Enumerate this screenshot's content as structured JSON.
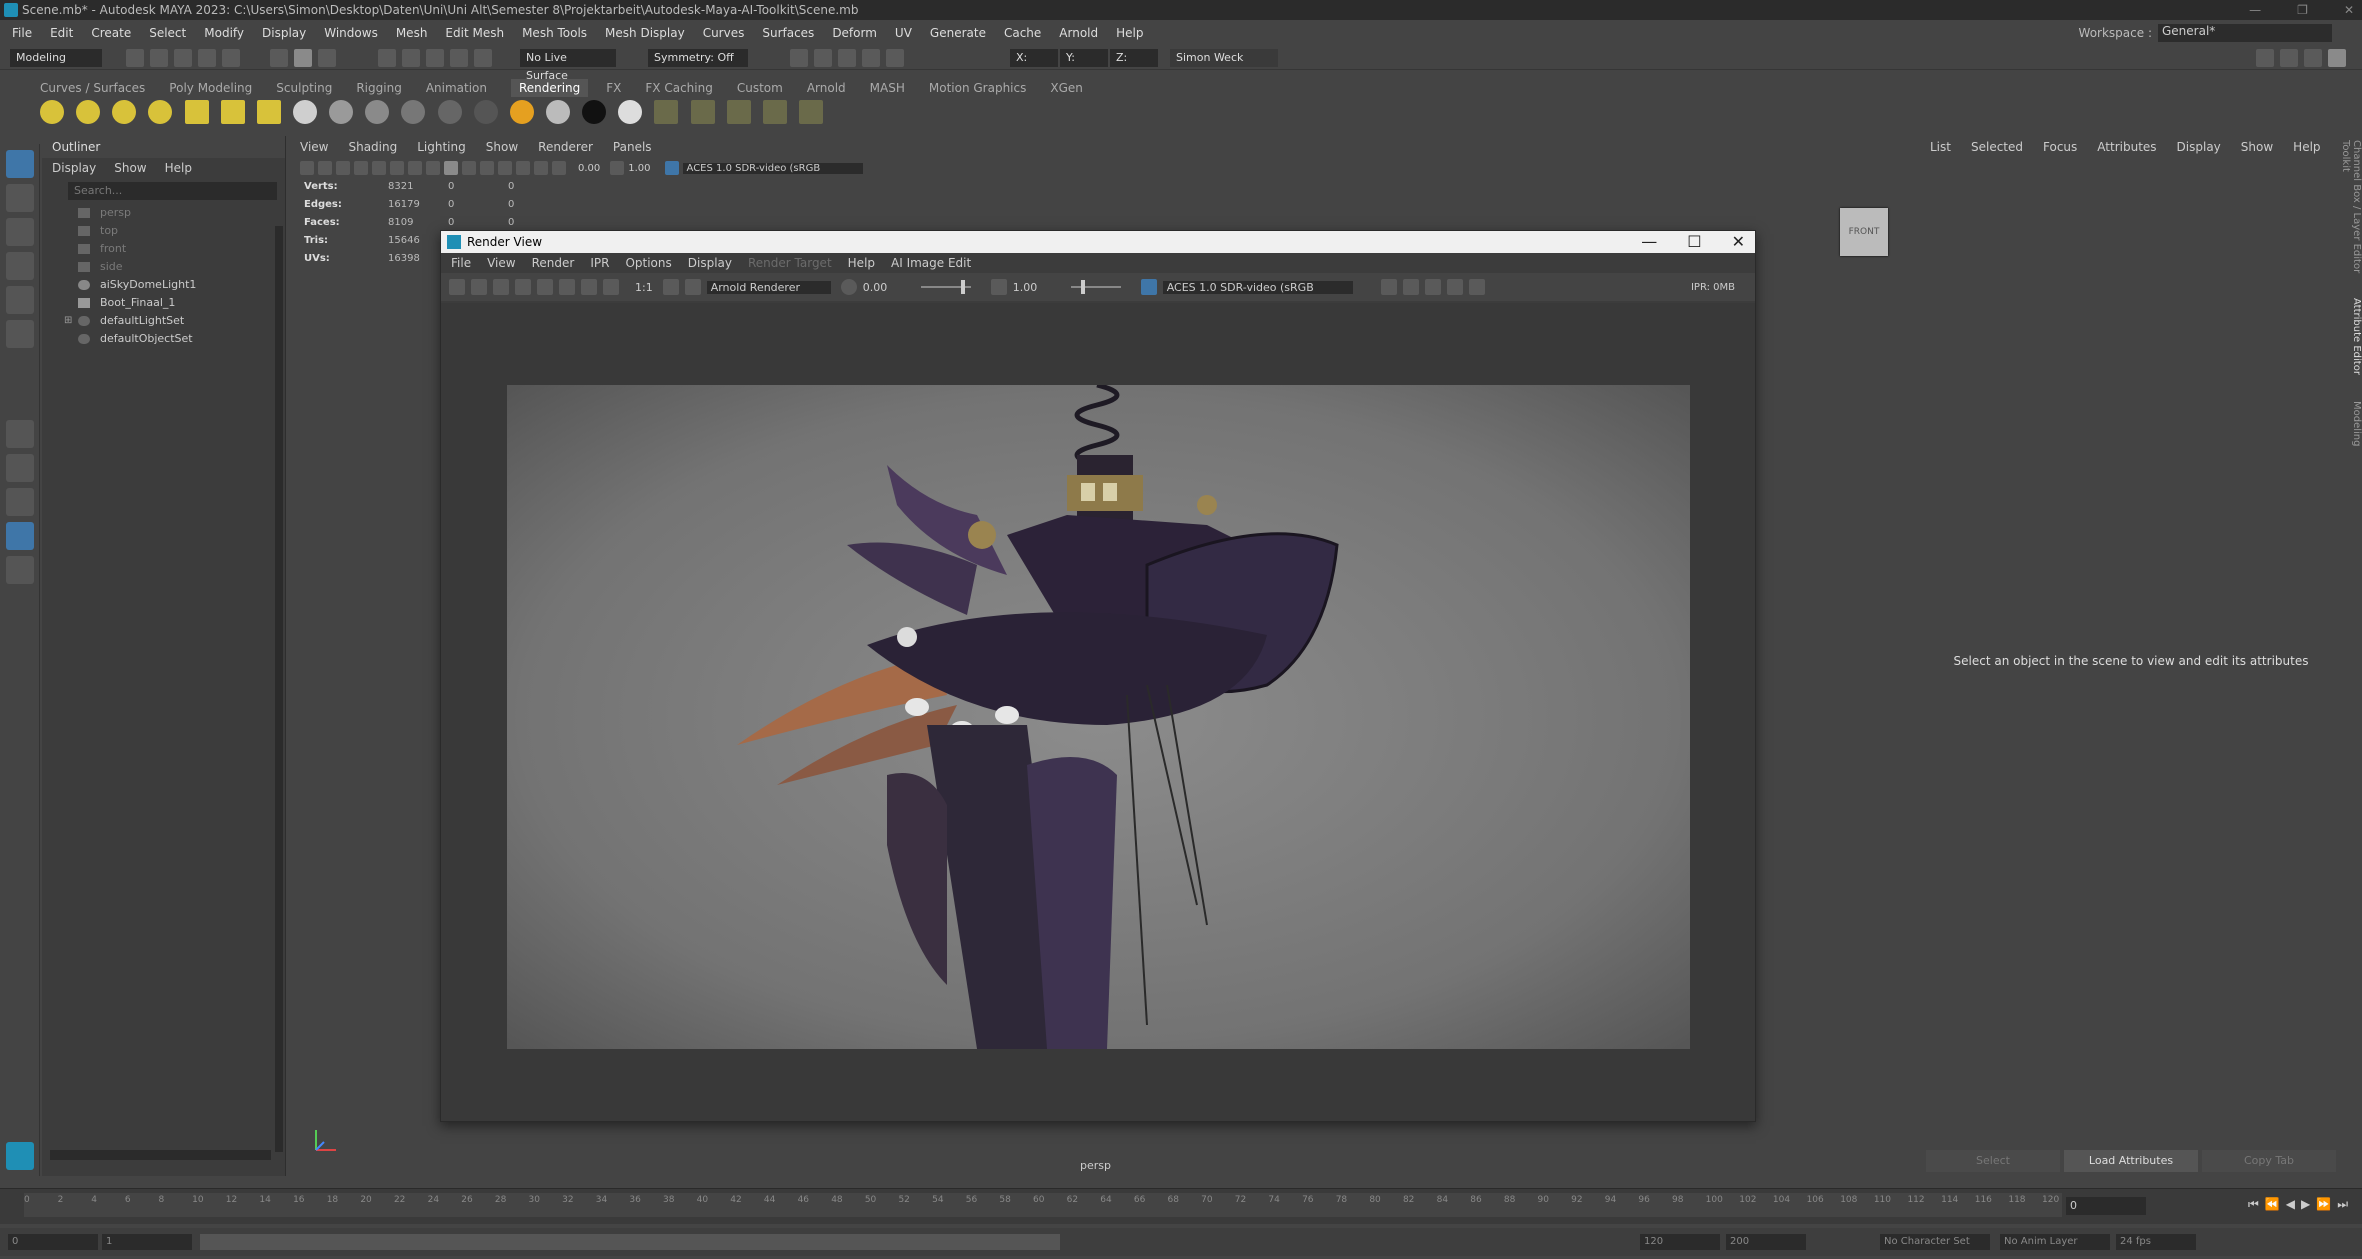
{
  "window": {
    "title": "Scene.mb* - Autodesk MAYA 2023: C:\\Users\\Simon\\Desktop\\Daten\\Uni\\Uni Alt\\Semester 8\\Projektarbeit\\Autodesk-Maya-AI-Toolkit\\Scene.mb"
  },
  "menubar": [
    "File",
    "Edit",
    "Create",
    "Select",
    "Modify",
    "Display",
    "Windows",
    "Mesh",
    "Edit Mesh",
    "Mesh Tools",
    "Mesh Display",
    "Curves",
    "Surfaces",
    "Deform",
    "UV",
    "Generate",
    "Cache",
    "Arnold",
    "Help"
  ],
  "workspace": {
    "label": "Workspace :",
    "value": "General*"
  },
  "statusline": {
    "mode": "Modeling",
    "live_surface": "No Live Surface",
    "symmetry": "Symmetry: Off",
    "x": "X:",
    "y": "Y:",
    "z": "Z:",
    "user": "Simon Weck"
  },
  "shelf_tabs": [
    "Curves / Surfaces",
    "Poly Modeling",
    "Sculpting",
    "Rigging",
    "Animation",
    "Rendering",
    "FX",
    "FX Caching",
    "Custom",
    "Arnold",
    "MASH",
    "Motion Graphics",
    "XGen"
  ],
  "shelf_active": "Rendering",
  "outliner": {
    "title": "Outliner",
    "menu": [
      "Display",
      "Show",
      "Help"
    ],
    "search_placeholder": "Search...",
    "items": [
      {
        "label": "persp",
        "dim": true
      },
      {
        "label": "top",
        "dim": true
      },
      {
        "label": "front",
        "dim": true
      },
      {
        "label": "side",
        "dim": true
      },
      {
        "label": "aiSkyDomeLight1",
        "dim": false
      },
      {
        "label": "Boot_Finaal_1",
        "dim": false
      },
      {
        "label": "defaultLightSet",
        "dim": false
      },
      {
        "label": "defaultObjectSet",
        "dim": false
      }
    ]
  },
  "viewport": {
    "menu": [
      "View",
      "Shading",
      "Lighting",
      "Show",
      "Renderer",
      "Panels"
    ],
    "exposure": "0.00",
    "gamma": "1.00",
    "color_space": "ACES 1.0 SDR-video (sRGB",
    "hud": [
      {
        "label": "Verts:",
        "a": "8321",
        "b": "0",
        "c": "0"
      },
      {
        "label": "Edges:",
        "a": "16179",
        "b": "0",
        "c": "0"
      },
      {
        "label": "Faces:",
        "a": "8109",
        "b": "0",
        "c": "0"
      },
      {
        "label": "Tris:",
        "a": "15646",
        "b": "0",
        "c": "0"
      },
      {
        "label": "UVs:",
        "a": "16398",
        "b": "0",
        "c": "0"
      }
    ],
    "cube_label": "FRONT",
    "camera": "persp"
  },
  "render_view": {
    "title": "Render View",
    "menu": [
      "File",
      "View",
      "Render",
      "IPR",
      "Options",
      "Display",
      "Render Target",
      "Help",
      "AI Image Edit"
    ],
    "ratio": "1:1",
    "renderer": "Arnold Renderer",
    "exposure": "0.00",
    "gamma": "1.00",
    "color_space": "ACES 1.0 SDR-video (sRGB",
    "ipr": "IPR: 0MB"
  },
  "attribute_editor": {
    "menu": [
      "List",
      "Selected",
      "Focus",
      "Attributes",
      "Display",
      "Show",
      "Help"
    ],
    "message": "Select an object in the scene to view and edit its attributes",
    "buttons": [
      "Select",
      "Load Attributes",
      "Copy Tab"
    ]
  },
  "side_tabs": [
    "Channel Box / Layer Editor",
    "Attribute Editor",
    "Modeling Toolkit"
  ],
  "timeline": {
    "ticks": [
      "0",
      "2",
      "4",
      "6",
      "8",
      "10",
      "12",
      "14",
      "16",
      "18",
      "20",
      "22",
      "24",
      "26",
      "28",
      "30",
      "32",
      "34",
      "36",
      "38",
      "40",
      "42",
      "44",
      "46",
      "48",
      "50",
      "52",
      "54",
      "56",
      "58",
      "60",
      "62",
      "64",
      "66",
      "68",
      "70",
      "72",
      "74",
      "76",
      "78",
      "80",
      "82",
      "84",
      "86",
      "88",
      "90",
      "92",
      "94",
      "96",
      "98",
      "100",
      "102",
      "104",
      "106",
      "108",
      "110",
      "112",
      "114",
      "116",
      "118",
      "120"
    ],
    "current_frame": "0",
    "start": "0",
    "end": "120",
    "range_start": "1",
    "range_end": "120",
    "max": "200",
    "character_set": "No Character Set",
    "anim_layer": "No Anim Layer",
    "fps": "24 fps"
  },
  "colors": {
    "accent": "#3f76a8",
    "brand": "#1f8fb5",
    "bg": "#444444"
  }
}
